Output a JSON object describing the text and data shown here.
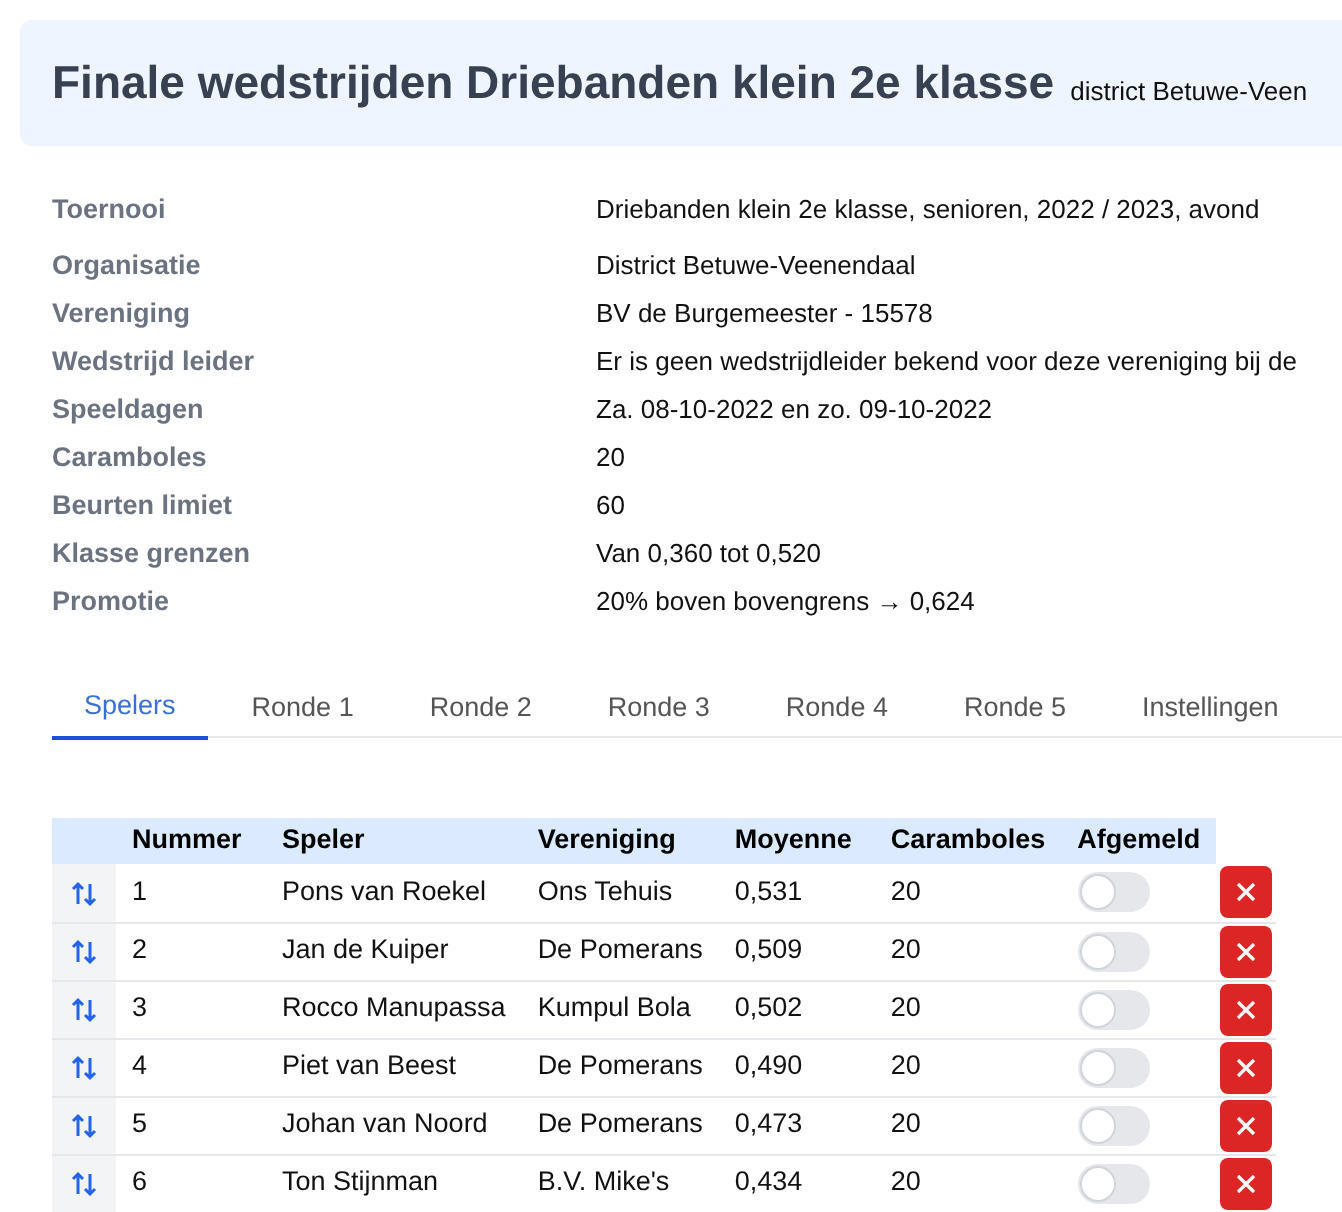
{
  "header": {
    "title": "Finale wedstrijden Driebanden klein 2e klasse",
    "subtitle": "district Betuwe-Veen"
  },
  "details": [
    {
      "label": "Toernooi",
      "value": "Driebanden klein 2e klasse, senioren, 2022 / 2023, avond"
    },
    {
      "label": "Organisatie",
      "value": "District Betuwe-Veenendaal"
    },
    {
      "label": "Vereniging",
      "value": "BV de Burgemeester - 15578"
    },
    {
      "label": "Wedstrijd leider",
      "value": "Er is geen wedstrijdleider bekend voor deze vereniging bij de"
    },
    {
      "label": "Speeldagen",
      "value": "Za. 08-10-2022 en zo. 09-10-2022"
    },
    {
      "label": "Caramboles",
      "value": "20"
    },
    {
      "label": "Beurten limiet",
      "value": "60"
    },
    {
      "label": "Klasse grenzen",
      "value": "Van 0,360 tot 0,520"
    },
    {
      "label": "Promotie",
      "value": "20% boven bovengrens → 0,624"
    }
  ],
  "tabs": [
    {
      "label": "Spelers",
      "selected": true
    },
    {
      "label": "Ronde 1",
      "selected": false
    },
    {
      "label": "Ronde 2",
      "selected": false
    },
    {
      "label": "Ronde 3",
      "selected": false
    },
    {
      "label": "Ronde 4",
      "selected": false
    },
    {
      "label": "Ronde 5",
      "selected": false
    },
    {
      "label": "Instellingen",
      "selected": false
    }
  ],
  "table": {
    "columns": [
      "Nummer",
      "Speler",
      "Vereniging",
      "Moyenne",
      "Caramboles",
      "Afgemeld"
    ],
    "rows": [
      {
        "nummer": "1",
        "speler": "Pons van Roekel",
        "vereniging": "Ons Tehuis",
        "moyenne": "0,531",
        "caramboles": "20",
        "afgemeld": false
      },
      {
        "nummer": "2",
        "speler": "Jan de Kuiper",
        "vereniging": "De Pomerans",
        "moyenne": "0,509",
        "caramboles": "20",
        "afgemeld": false
      },
      {
        "nummer": "3",
        "speler": "Rocco Manupassa",
        "vereniging": "Kumpul Bola",
        "moyenne": "0,502",
        "caramboles": "20",
        "afgemeld": false
      },
      {
        "nummer": "4",
        "speler": "Piet van Beest",
        "vereniging": "De Pomerans",
        "moyenne": "0,490",
        "caramboles": "20",
        "afgemeld": false
      },
      {
        "nummer": "5",
        "speler": "Johan van Noord",
        "vereniging": "De Pomerans",
        "moyenne": "0,473",
        "caramboles": "20",
        "afgemeld": false
      },
      {
        "nummer": "6",
        "speler": "Ton Stijnman",
        "vereniging": "B.V. Mike's",
        "moyenne": "0,434",
        "caramboles": "20",
        "afgemeld": false
      }
    ]
  }
}
